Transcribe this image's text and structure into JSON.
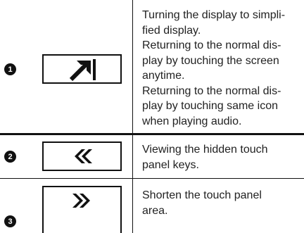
{
  "rows": [
    {
      "marker": "1",
      "icon": "enter-arrow-icon",
      "lines": [
        "Turning the display to simpli-",
        "fied display.",
        "Returning to the normal dis-",
        "play by touching the screen",
        "anytime.",
        "Returning to the normal dis-",
        "play by touching same icon",
        "when playing audio."
      ]
    },
    {
      "marker": "2",
      "icon": "double-chevron-left-icon",
      "lines": [
        "Viewing the hidden touch",
        "panel keys."
      ]
    },
    {
      "marker": "3",
      "icon": "double-chevron-right-icon",
      "lines": [
        "Shorten the touch panel",
        "area."
      ]
    }
  ]
}
